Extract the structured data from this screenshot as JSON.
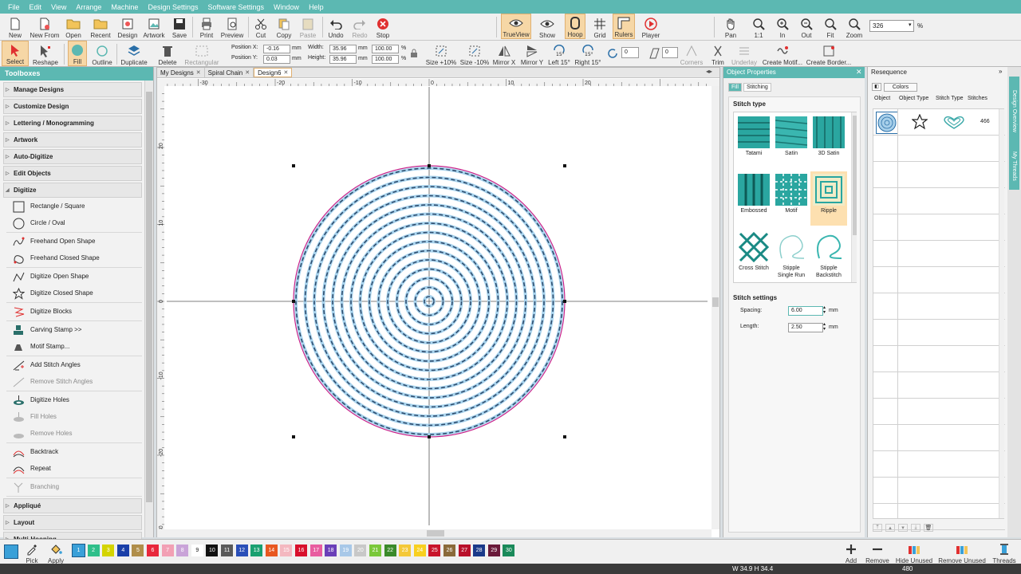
{
  "menu": [
    "File",
    "Edit",
    "View",
    "Arrange",
    "Machine",
    "Design Settings",
    "Software Settings",
    "Window",
    "Help"
  ],
  "toolbar1": {
    "new": "New",
    "new_from": "New From",
    "open": "Open",
    "recent": "Recent",
    "design": "Design",
    "artwork": "Artwork",
    "save": "Save",
    "print": "Print",
    "preview": "Preview",
    "cut": "Cut",
    "copy": "Copy",
    "paste": "Paste",
    "undo": "Undo",
    "redo": "Redo",
    "stop": "Stop",
    "trueview": "TrueView",
    "show": "Show",
    "hoop": "Hoop",
    "grid": "Grid",
    "rulers": "Rulers",
    "player": "Player",
    "pan": "Pan",
    "one_one": "1:1",
    "zoom_in": "In",
    "zoom_out": "Out",
    "fit": "Fit",
    "zoom": "Zoom",
    "zoom_value": "326",
    "zoom_unit": "%"
  },
  "toolbar2": {
    "select": "Select",
    "reshape": "Reshape",
    "fill": "Fill",
    "outline": "Outline",
    "duplicate": "Duplicate",
    "delete": "Delete",
    "rectangular": "Rectangular",
    "pos_x_label": "Position X:",
    "pos_x": "-0.16",
    "pos_y_label": "Position Y:",
    "pos_y": "0.03",
    "mm": "mm",
    "width_label": "Width:",
    "width": "35.96",
    "height_label": "Height:",
    "height": "35.96",
    "pct_w": "100.00",
    "pct_h": "100.00",
    "pct": "%",
    "size_up": "Size +10%",
    "size_down": "Size -10%",
    "mirror_x": "Mirror X",
    "mirror_y": "Mirror Y",
    "left15": "Left 15°",
    "right15": "Right 15°",
    "rot_deg": "15°",
    "rotate_value": "0",
    "slant_value": "0",
    "corners": "Corners",
    "trim": "Trim",
    "underlay": "Underlay",
    "create_motif": "Create Motif...",
    "create_border": "Create Border..."
  },
  "toolboxes": {
    "title": "Toolboxes",
    "categories_top": [
      "Manage Designs",
      "Customize Design",
      "Lettering / Monogramming",
      "Artwork",
      "Auto-Digitize",
      "Edit Objects"
    ],
    "digitize": "Digitize",
    "tools": [
      {
        "label": "Rectangle / Square",
        "icon": "rectangle-icon",
        "enabled": true,
        "sep": false
      },
      {
        "label": "Circle / Oval",
        "icon": "circle-icon",
        "enabled": true,
        "sep": true
      },
      {
        "label": "Freehand Open Shape",
        "icon": "freehand-open-icon",
        "enabled": true,
        "sep": false
      },
      {
        "label": "Freehand Closed Shape",
        "icon": "freehand-closed-icon",
        "enabled": true,
        "sep": true
      },
      {
        "label": "Digitize Open Shape",
        "icon": "digitize-open-icon",
        "enabled": true,
        "sep": false
      },
      {
        "label": "Digitize Closed Shape",
        "icon": "star-icon",
        "enabled": true,
        "sep": true
      },
      {
        "label": "Digitize Blocks",
        "icon": "blocks-icon",
        "enabled": true,
        "sep": true
      },
      {
        "label": "Carving Stamp >>",
        "icon": "stamp-icon",
        "enabled": true,
        "sep": false
      },
      {
        "label": "Motif Stamp...",
        "icon": "motif-stamp-icon",
        "enabled": true,
        "sep": true
      },
      {
        "label": "Add Stitch Angles",
        "icon": "add-angle-icon",
        "enabled": true,
        "sep": false
      },
      {
        "label": "Remove Stitch Angles",
        "icon": "remove-angle-icon",
        "enabled": false,
        "sep": true
      },
      {
        "label": "Digitize Holes",
        "icon": "holes-icon",
        "enabled": true,
        "sep": false
      },
      {
        "label": "Fill Holes",
        "icon": "fill-holes-icon",
        "enabled": false,
        "sep": false
      },
      {
        "label": "Remove Holes",
        "icon": "remove-holes-icon",
        "enabled": false,
        "sep": true
      },
      {
        "label": "Backtrack",
        "icon": "backtrack-icon",
        "enabled": true,
        "sep": false
      },
      {
        "label": "Repeat",
        "icon": "repeat-icon",
        "enabled": true,
        "sep": true
      },
      {
        "label": "Branching",
        "icon": "branching-icon",
        "enabled": false,
        "sep": true
      }
    ],
    "categories_bottom": [
      "Appliqué",
      "Layout",
      "Multi-Hooping"
    ]
  },
  "tabs": [
    "My Designs",
    "Spiral Chain",
    "Design6"
  ],
  "rulers": {
    "h": [
      "-30",
      "-20",
      "-10",
      "0",
      "10",
      "20"
    ],
    "v": [
      "20",
      "10",
      "0",
      "-10",
      "-20",
      "-30"
    ]
  },
  "object_properties": {
    "title": "Object Properties",
    "tab_fill": "Fill",
    "tab_stitching": "Stitching",
    "stitch_type_title": "Stitch type",
    "types": [
      "Tatami",
      "Satin",
      "3D Satin",
      "Embossed",
      "Motif",
      "Ripple",
      "Cross Stitch",
      "Stipple Single Run",
      "Stipple Backstitch"
    ],
    "types_line1": [
      "Tatami",
      "Satin",
      "3D Satin",
      "Embossed",
      "Motif",
      "Ripple",
      "Cross Stitch",
      "Stipple",
      "Stipple"
    ],
    "types_line2": [
      "",
      "",
      "",
      "",
      "",
      "",
      "",
      "Single Run",
      "Backstitch"
    ],
    "selected": "Ripple",
    "settings_title": "Stitch settings",
    "spacing_label": "Spacing:",
    "spacing": "6.00",
    "length_label": "Length:",
    "length": "2.50",
    "unit": "mm"
  },
  "resequence": {
    "title": "Resequence",
    "colors_btn": "Colors",
    "cols": [
      "Object",
      "Object Type",
      "Stitch Type",
      "Stitches"
    ],
    "row_stitches": "466"
  },
  "side_tabs": [
    "Design Overview",
    "My Threads"
  ],
  "bottom": {
    "pick": "Pick",
    "apply": "Apply",
    "colors": [
      {
        "n": "1",
        "c": "#3aa0d8"
      },
      {
        "n": "2",
        "c": "#2fbf8a"
      },
      {
        "n": "3",
        "c": "#d4d400"
      },
      {
        "n": "4",
        "c": "#1a3fa8"
      },
      {
        "n": "5",
        "c": "#b08e4a"
      },
      {
        "n": "6",
        "c": "#e8283c"
      },
      {
        "n": "7",
        "c": "#f2a0b4"
      },
      {
        "n": "8",
        "c": "#c9a3d8"
      },
      {
        "n": "9",
        "c": "#ffffff"
      },
      {
        "n": "10",
        "c": "#111111"
      },
      {
        "n": "11",
        "c": "#5a5a5a"
      },
      {
        "n": "12",
        "c": "#2a4fb8"
      },
      {
        "n": "13",
        "c": "#1aa070"
      },
      {
        "n": "14",
        "c": "#e85820"
      },
      {
        "n": "15",
        "c": "#f4b8c0"
      },
      {
        "n": "16",
        "c": "#d8102c"
      },
      {
        "n": "17",
        "c": "#e85ca0"
      },
      {
        "n": "18",
        "c": "#6a3fb8"
      },
      {
        "n": "19",
        "c": "#a8c8e8"
      },
      {
        "n": "20",
        "c": "#c8c8c8"
      },
      {
        "n": "21",
        "c": "#7ac83a"
      },
      {
        "n": "22",
        "c": "#3a8a2a"
      },
      {
        "n": "23",
        "c": "#f4c838"
      },
      {
        "n": "24",
        "c": "#f8d020"
      },
      {
        "n": "25",
        "c": "#c8142a"
      },
      {
        "n": "26",
        "c": "#8a6a3a"
      },
      {
        "n": "27",
        "c": "#b8102a"
      },
      {
        "n": "28",
        "c": "#1a3a8a"
      },
      {
        "n": "29",
        "c": "#6a1a3a"
      },
      {
        "n": "30",
        "c": "#1a8a5a"
      }
    ],
    "add": "Add",
    "remove": "Remove",
    "hide_unused": "Hide Unused",
    "remove_unused": "Remove Unused",
    "threads": "Threads"
  },
  "status": {
    "wh": "W 34.9 H 34.4",
    "stitches": "480"
  }
}
